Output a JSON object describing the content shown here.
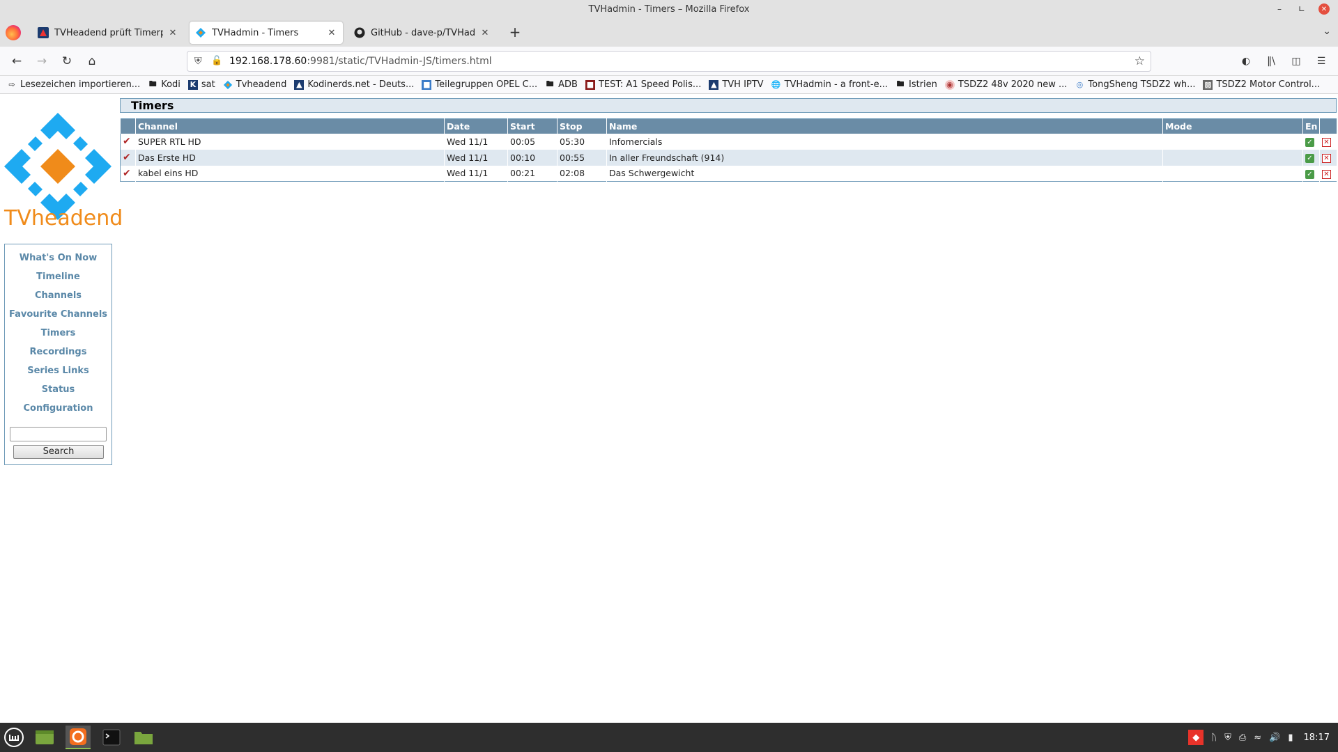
{
  "window": {
    "title": "TVHadmin - Timers – Mozilla Firefox"
  },
  "tabs": [
    {
      "label": "TVHeadend prüft Timerpro",
      "active": false
    },
    {
      "label": "TVHadmin - Timers",
      "active": true
    },
    {
      "label": "GitHub - dave-p/TVHadmin",
      "active": false
    }
  ],
  "url": {
    "host": "192.168.178.60",
    "rest": ":9981/static/TVHadmin-JS/timers.html"
  },
  "bookmarks": [
    {
      "label": "Lesezeichen importieren...",
      "icon": "import-icon"
    },
    {
      "label": "Kodi",
      "icon": "folder-icon"
    },
    {
      "label": "sat",
      "icon": "k-icon"
    },
    {
      "label": "Tvheadend",
      "icon": "tvheadend-icon"
    },
    {
      "label": "Kodinerds.net - Deuts...",
      "icon": "kodinerds-icon"
    },
    {
      "label": "Teilegruppen OPEL C...",
      "icon": "opel-icon"
    },
    {
      "label": "ADB",
      "icon": "folder-icon"
    },
    {
      "label": "TEST: A1 Speed Polis...",
      "icon": "a1-icon"
    },
    {
      "label": "TVH IPTV",
      "icon": "kodinerds-icon"
    },
    {
      "label": "TVHadmin - a front-e...",
      "icon": "globe-icon"
    },
    {
      "label": "Istrien",
      "icon": "folder-icon"
    },
    {
      "label": "TSDZ2 48v 2020 new ...",
      "icon": "tsdz-icon"
    },
    {
      "label": "TongSheng TSDZ2 wh...",
      "icon": "tongsheng-icon"
    },
    {
      "label": "TSDZ2 Motor Control...",
      "icon": "motor-icon"
    }
  ],
  "app": {
    "logo_text": "TVheadend"
  },
  "sidebar": {
    "items": [
      {
        "label": "What's On Now"
      },
      {
        "label": "Timeline"
      },
      {
        "label": "Channels"
      },
      {
        "label": "Favourite Channels"
      },
      {
        "label": "Timers"
      },
      {
        "label": "Recordings"
      },
      {
        "label": "Series Links"
      },
      {
        "label": "Status"
      },
      {
        "label": "Configuration"
      }
    ],
    "search_value": "",
    "search_button": "Search"
  },
  "main": {
    "heading": "Timers",
    "columns": [
      "Channel",
      "Date",
      "Start",
      "Stop",
      "Name",
      "Mode",
      "En"
    ],
    "rows": [
      {
        "channel": "SUPER RTL HD",
        "date": "Wed 11/1",
        "start": "00:05",
        "stop": "05:30",
        "name": "Infomercials",
        "mode": ""
      },
      {
        "channel": "Das Erste HD",
        "date": "Wed 11/1",
        "start": "00:10",
        "stop": "00:55",
        "name": "In aller Freundschaft (914)",
        "mode": ""
      },
      {
        "channel": "kabel eins HD",
        "date": "Wed 11/1",
        "start": "00:21",
        "stop": "02:08",
        "name": "Das Schwergewicht",
        "mode": ""
      }
    ]
  },
  "taskbar": {
    "clock": "18:17"
  },
  "colors": {
    "accent": "#6a8ca6",
    "menu_text": "#5a88a8",
    "logo_blue": "#1eaaf1",
    "logo_orange": "#f08b1a"
  }
}
